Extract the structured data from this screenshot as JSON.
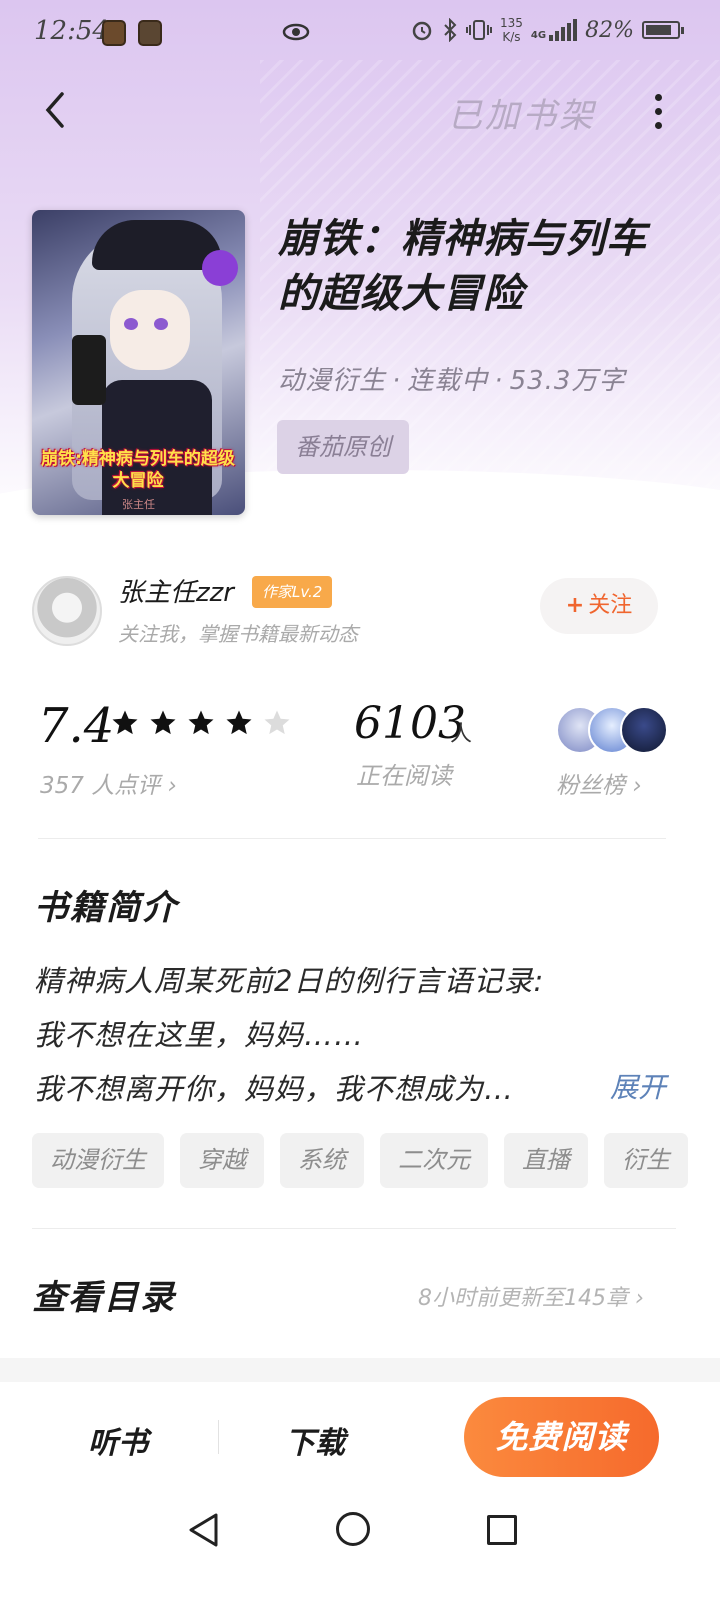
{
  "status_bar": {
    "time": "12:54",
    "net_speed_value": "135",
    "net_speed_unit": "K/s",
    "network_type": "4G",
    "battery_percent": "82%",
    "battery_level": 0.82,
    "icons": [
      "app-icon-1",
      "app-icon-2",
      "eye-icon",
      "alarm-icon",
      "bluetooth-icon",
      "vibrate-icon",
      "signal-icon",
      "battery-icon"
    ]
  },
  "nav": {
    "shelf_label": "已加书架"
  },
  "book": {
    "cover_title": "崩铁:精神病与列车的超级大冒险",
    "cover_author": "张主任",
    "title": "崩铁：精神病与列车的超级大冒险",
    "genre": "动漫衍生",
    "status": "连载中",
    "word_count": "53.3万字",
    "separator": "·",
    "tag": "番茄原创"
  },
  "author": {
    "name": "张主任zzr",
    "badge": "作家Lv.2",
    "subtitle": "关注我，掌握书籍最新动态",
    "follow_plus": "+",
    "follow_label": "关注"
  },
  "stats": {
    "score": "7.4",
    "stars_filled": 4,
    "stars_total": 5,
    "reviews": "357 人点评",
    "readers": "6103",
    "readers_unit": "人",
    "readers_label": "正在阅读",
    "fans_label": "粉丝榜",
    "chevron": "›"
  },
  "intro": {
    "title": "书籍简介",
    "lines": [
      "精神病人周某死前2日的例行言语记录:",
      "我不想在这里，妈妈……",
      "我不想离开你，妈妈，我不想成为…"
    ],
    "expand": "展开"
  },
  "tags": [
    "动漫衍生",
    "穿越",
    "系统",
    "二次元",
    "直播",
    "衍生"
  ],
  "catalog": {
    "title": "查看目录",
    "update": "8小时前更新至145章"
  },
  "bottom_bar": {
    "listen": "听书",
    "download": "下载",
    "read": "免费阅读"
  },
  "colors": {
    "accent": "#f66a2c",
    "link": "#5d82b8",
    "badge": "#f8a94a"
  }
}
